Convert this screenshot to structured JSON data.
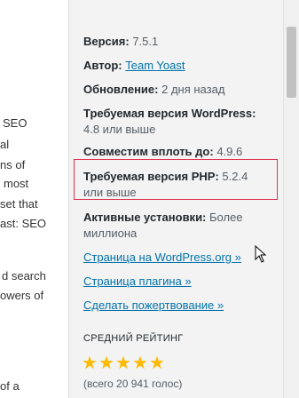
{
  "description_fragments": [
    "SEO",
    "al",
    "ns of",
    "most",
    "set that",
    "ast: SEO",
    "d search",
    "owers of",
    "of a"
  ],
  "details": [
    {
      "label": "Версия:",
      "value": "7.5.1"
    },
    {
      "label": "Автор:",
      "value": "Team Yoast"
    },
    {
      "label": "Обновление:",
      "value": "2 дня назад"
    },
    {
      "label": "Требуемая версия WordPress:",
      "value": "4.8 или выше"
    },
    {
      "label": "Совместим вплоть до:",
      "value": "4.9.6"
    },
    {
      "label": "Требуемая версия PHP:",
      "value": "5.2.4 или выше"
    },
    {
      "label": "Активные установки:",
      "value": "Более миллиона"
    }
  ],
  "links": {
    "wp_page": "Страница на WordPress.org »",
    "plugin_page": "Страница плагина »",
    "donate": "Сделать пожертвование »"
  },
  "rating": {
    "title": "СРЕДНИЙ РЕЙТИНГ",
    "stars": 5,
    "max_stars": 5,
    "votes": "(всего 20 941 голос)"
  },
  "colors": {
    "link": "#0073aa",
    "star": "#ffb900",
    "highlight_border": "#e0304b"
  }
}
